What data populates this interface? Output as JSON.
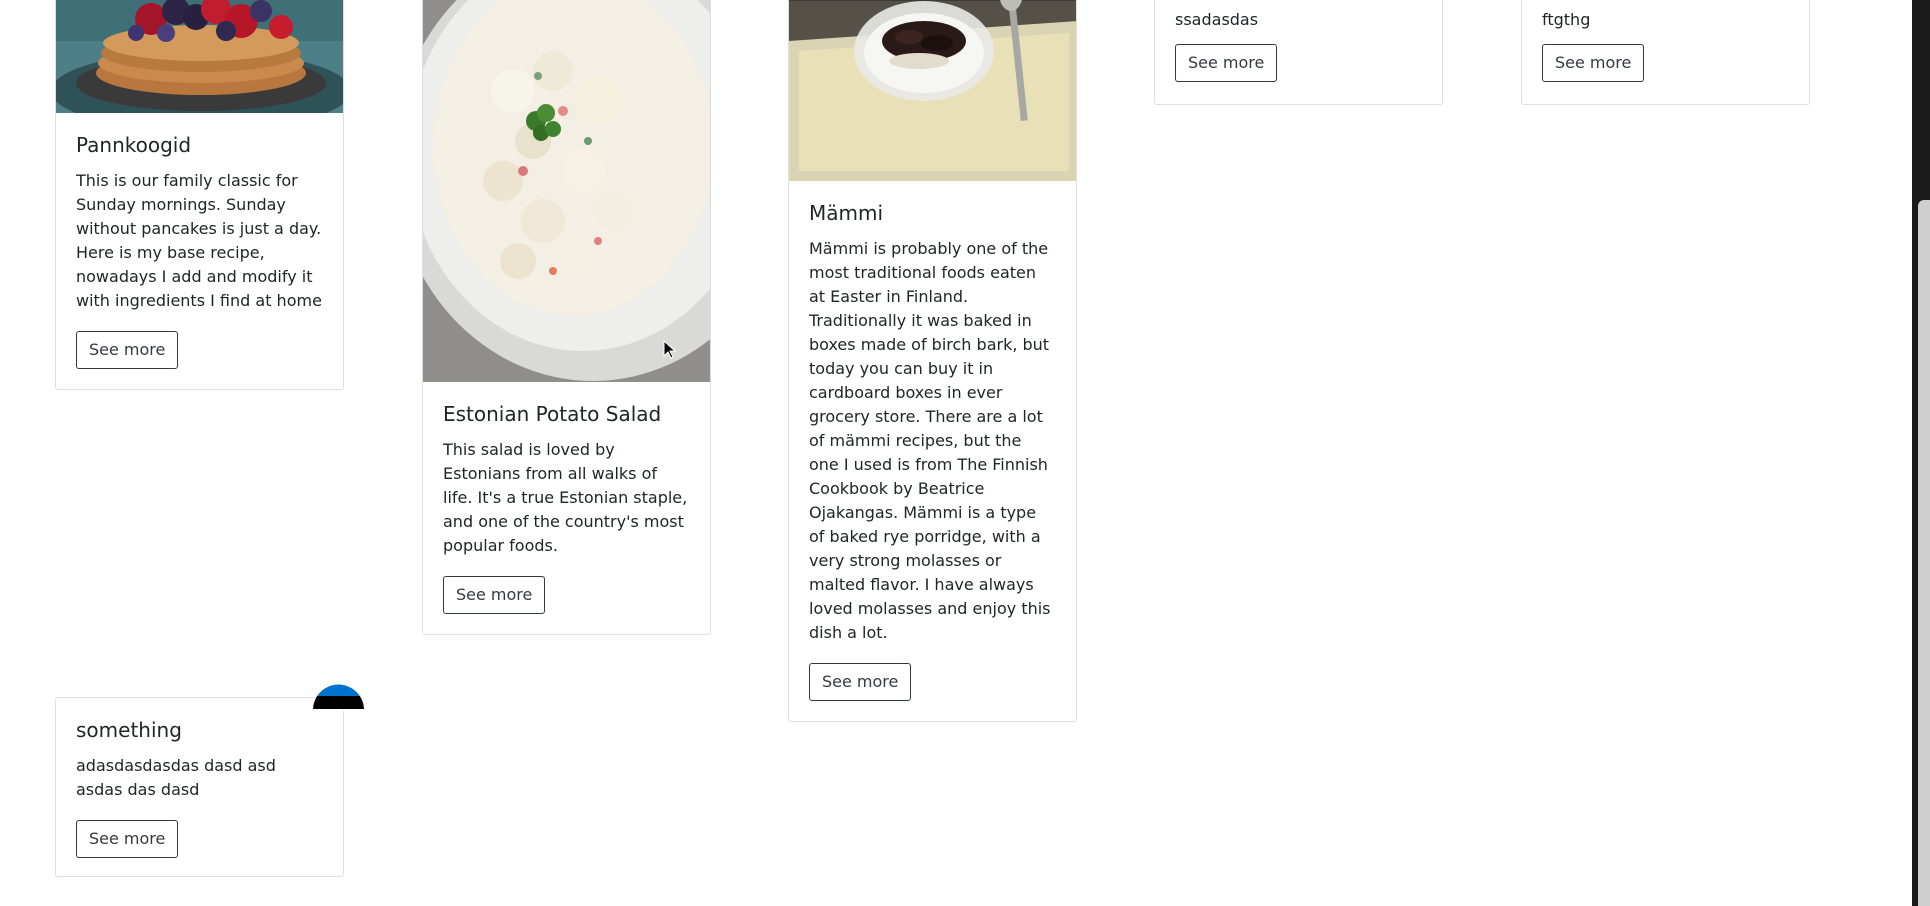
{
  "cards": [
    {
      "title": "Pannkoogid",
      "text": "This is our family classic for Sunday mornings. Sunday without pancakes is just a day. Here is my base recipe, nowadays I add and modify it with ingredients I find at home",
      "button": "See more"
    },
    {
      "title": "Estonian Potato Salad",
      "text": "This salad is loved by Estonians from all walks of life. It's a true Estonian staple, and one of the country's most popular foods.",
      "button": "See more"
    },
    {
      "title": "Mämmi",
      "text": "Mämmi is probably one of the most traditional foods eaten at Easter in Finland. Traditionally it was baked in boxes made of birch bark, but today you can buy it in cardboard boxes in ever grocery store. There are a lot of mämmi recipes, but the one I used is from The Finnish Cookbook by Beatrice Ojakangas. Mämmi is a type of baked rye porridge, with a very strong molasses or malted flavor. I have always loved molasses and enjoy this dish a lot.",
      "button": "See more"
    },
    {
      "title": "",
      "text": "ssadasdas",
      "button": "See more"
    },
    {
      "title": "",
      "text": "ftgthg",
      "button": "See more"
    },
    {
      "title": "something",
      "text": "adasdasdasdas dasd asd asdas das dasd",
      "button": "See more"
    }
  ],
  "colors": {
    "button_border": "#343a40",
    "card_border": "#dfdfdf",
    "flag_blue": "#0072CE",
    "flag_black": "#000000",
    "flag_white": "#ffffff"
  },
  "icons": [
    "cursor-icon",
    "estonia-flag-icon"
  ]
}
